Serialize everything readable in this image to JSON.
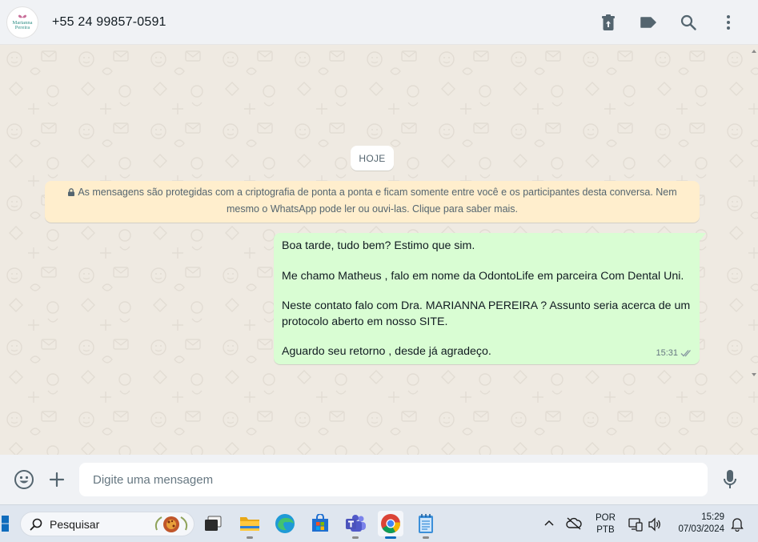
{
  "header": {
    "avatar_logo_lines": [
      "Marianna",
      "Pereira"
    ],
    "contact_name": "+55 24 99857-0591",
    "actions": [
      "delete-icon",
      "label-icon",
      "search-icon",
      "menu-icon"
    ]
  },
  "chat": {
    "date_chip": "HOJE",
    "encryption_notice_line1": "As mensagens são protegidas com a criptografia de ponta a ponta e ficam somente entre você e os participantes desta conversa. Nem",
    "encryption_notice_line2": "mesmo o WhatsApp pode ler ou ouvi-las. Clique para saber mais.",
    "message": {
      "line1": "Boa tarde, tudo bem? Estimo que sim.",
      "line2": "Me chamo Matheus , falo em nome da OdontoLife em parceira Com Dental Uni.",
      "line3a": "Neste contato falo com Dra. MARIANNA PEREIRA ? Assunto seria acerca de um",
      "line3b": "protocolo aberto em nosso SITE.",
      "line4": "Aguardo seu retorno , desde já agradeço.",
      "time": "15:31",
      "status": "delivered"
    }
  },
  "composer": {
    "placeholder": "Digite uma mensagem",
    "value": ""
  },
  "taskbar": {
    "search_label": "Pesquisar",
    "language_line1": "POR",
    "language_line2": "PTB",
    "time": "15:29",
    "date": "07/03/2024"
  },
  "colors": {
    "outgoing_bubble": "#d9fdd3",
    "encryption_notice_bg": "#ffeecd",
    "chat_bg": "#efeae2",
    "header_bg": "#f0f2f5",
    "icon": "#54656f"
  }
}
